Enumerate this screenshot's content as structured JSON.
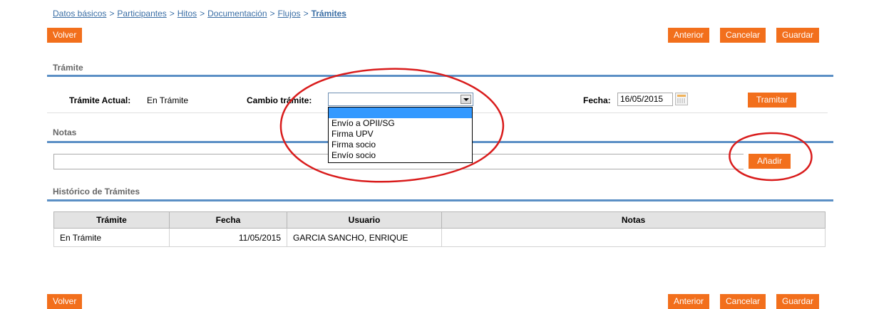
{
  "breadcrumb": {
    "items": [
      "Datos básicos",
      "Participantes",
      "Hitos",
      "Documentación",
      "Flujos"
    ],
    "separator": ">",
    "current": "Trámites"
  },
  "toolbar": {
    "volver": "Volver",
    "anterior": "Anterior",
    "cancelar": "Cancelar",
    "guardar": "Guardar"
  },
  "tramite": {
    "section_title": "Trámite",
    "actual_label": "Trámite Actual:",
    "actual_value": "En Trámite",
    "cambio_label": "Cambio trámite:",
    "cambio_selected": "",
    "options": [
      "",
      "Envío a OPII/SG",
      "Firma UPV",
      "Firma socio",
      "Envío socio"
    ],
    "fecha_label": "Fecha:",
    "fecha_value": "16/05/2015",
    "tramitar": "Tramitar"
  },
  "notas": {
    "section_title": "Notas",
    "value": "",
    "add_button": "Añadir"
  },
  "historico": {
    "section_title": "Histórico de Trámites",
    "columns": [
      "Trámite",
      "Fecha",
      "Usuario",
      "Notas"
    ],
    "rows": [
      [
        "En Trámite",
        "11/05/2015",
        "GARCIA SANCHO, ENRIQUE",
        ""
      ]
    ]
  },
  "colors": {
    "accent": "#f26f1c",
    "section_line": "#5b8fc5",
    "link": "#3a6ea5",
    "highlight": "#3399ff",
    "annotation": "#d91c1c"
  },
  "icons": {
    "calendar": "calendar-icon",
    "dropdown": "chevron-down-icon"
  }
}
